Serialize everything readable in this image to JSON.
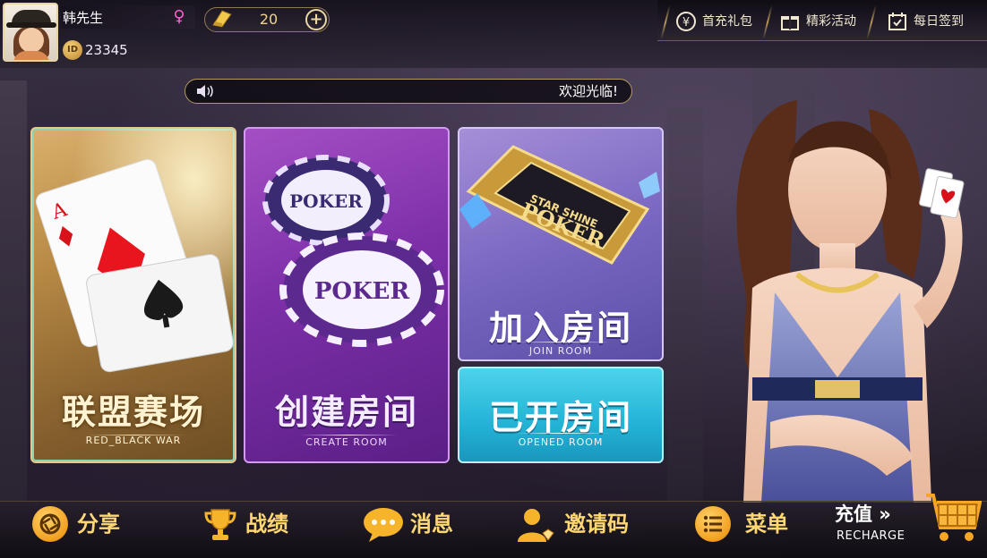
{
  "player": {
    "nickname": "韩先生",
    "id_label": "ID",
    "id_value": "23345",
    "gender_icon": "female-symbol-icon"
  },
  "currency": {
    "amount": "20",
    "icon": "gold-card-icon",
    "add_icon": "plus-icon"
  },
  "top_menu": [
    {
      "label": "首充礼包",
      "icon": "yen-coin-icon"
    },
    {
      "label": "精彩活动",
      "icon": "gift-icon"
    },
    {
      "label": "每日签到",
      "icon": "calendar-check-icon"
    }
  ],
  "marquee": {
    "text": "欢迎光临!",
    "icon": "speaker-icon"
  },
  "cards": {
    "alliance": {
      "title": "联盟赛场",
      "subtitle": "RED_BLACK WAR"
    },
    "create": {
      "title": "创建房间",
      "subtitle": "CREATE ROOM"
    },
    "join": {
      "title": "加入房间",
      "subtitle": "JOIN ROOM"
    },
    "opened": {
      "title": "已开房间",
      "subtitle": "OPENED ROOM"
    }
  },
  "art_text": {
    "poker": "POKER",
    "star_shine": "STAR SHINE",
    "ace": "A"
  },
  "bottom_nav": [
    {
      "label": "分享",
      "icon": "share-aperture-icon"
    },
    {
      "label": "战绩",
      "icon": "trophy-icon"
    },
    {
      "label": "消息",
      "icon": "chat-bubble-icon"
    },
    {
      "label": "邀请码",
      "icon": "user-invite-icon"
    },
    {
      "label": "菜单",
      "icon": "menu-list-icon"
    }
  ],
  "recharge": {
    "label": "充值 »",
    "sublabel": "RECHARGE",
    "icon": "shopping-cart-icon"
  },
  "colors": {
    "accent_gold": "#ffd873",
    "card_gold": "#b88a45",
    "card_purple": "#7d2fa8",
    "card_violet": "#7a68c2",
    "card_cyan": "#22b3d6"
  }
}
